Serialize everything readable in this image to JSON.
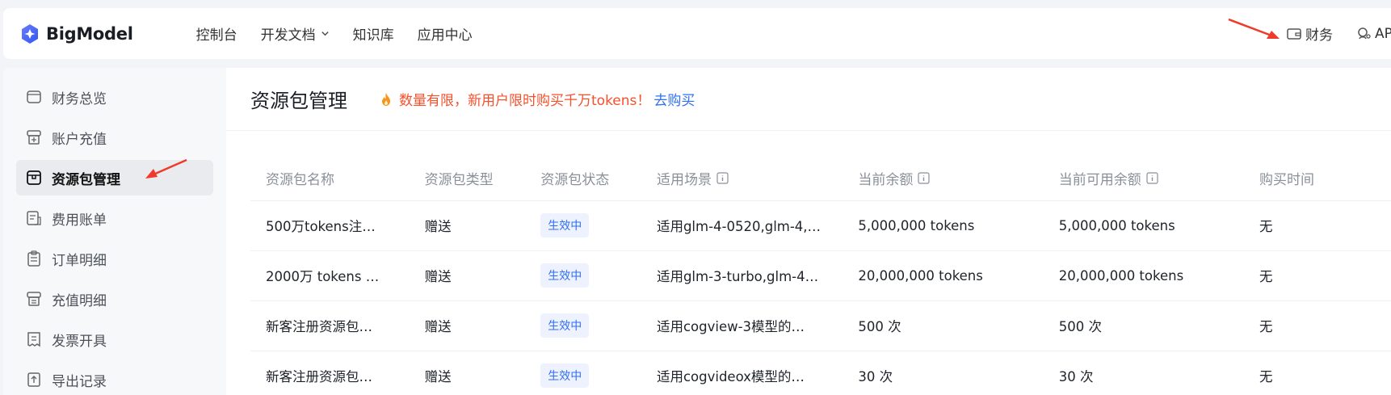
{
  "app": {
    "logo_text": "BigModel"
  },
  "topnav": {
    "items": [
      "控制台",
      "开发文档",
      "知识库",
      "应用中心"
    ],
    "right_items": [
      "财务",
      "API"
    ]
  },
  "sidebar": {
    "items": [
      {
        "label": "财务总览",
        "icon": "wallet-icon"
      },
      {
        "label": "账户充值",
        "icon": "recharge-icon"
      },
      {
        "label": "资源包管理",
        "icon": "package-icon",
        "active": true
      },
      {
        "label": "费用账单",
        "icon": "bill-icon"
      },
      {
        "label": "订单明细",
        "icon": "clipboard-icon"
      },
      {
        "label": "充值明细",
        "icon": "recharge-detail-icon"
      },
      {
        "label": "发票开具",
        "icon": "invoice-icon"
      },
      {
        "label": "导出记录",
        "icon": "export-icon"
      }
    ]
  },
  "main": {
    "title": "资源包管理",
    "promo_text": "数量有限，新用户限时购买千万tokens！",
    "promo_link": "去购买",
    "table": {
      "headers": [
        "资源包名称",
        "资源包类型",
        "资源包状态",
        "适用场景",
        "当前余额",
        "当前可用余额",
        "购买时间"
      ],
      "rows": [
        [
          "500万tokens注…",
          "赠送",
          "生效中",
          "适用glm-4-0520,glm-4,…",
          "5,000,000 tokens",
          "5,000,000 tokens",
          "无"
        ],
        [
          "2000万 tokens …",
          "赠送",
          "生效中",
          "适用glm-3-turbo,glm-4…",
          "20,000,000 tokens",
          "20,000,000 tokens",
          "无"
        ],
        [
          "新客注册资源包…",
          "赠送",
          "生效中",
          "适用cogview-3模型的…",
          "500 次",
          "500 次",
          "无"
        ],
        [
          "新客注册资源包…",
          "赠送",
          "生效中",
          "适用cogvideox模型的…",
          "30 次",
          "30 次",
          "无"
        ]
      ]
    }
  },
  "colors": {
    "accent": "#2f6ff5",
    "promo": "#f4502d",
    "annotation_arrow": "#f03a2a"
  }
}
